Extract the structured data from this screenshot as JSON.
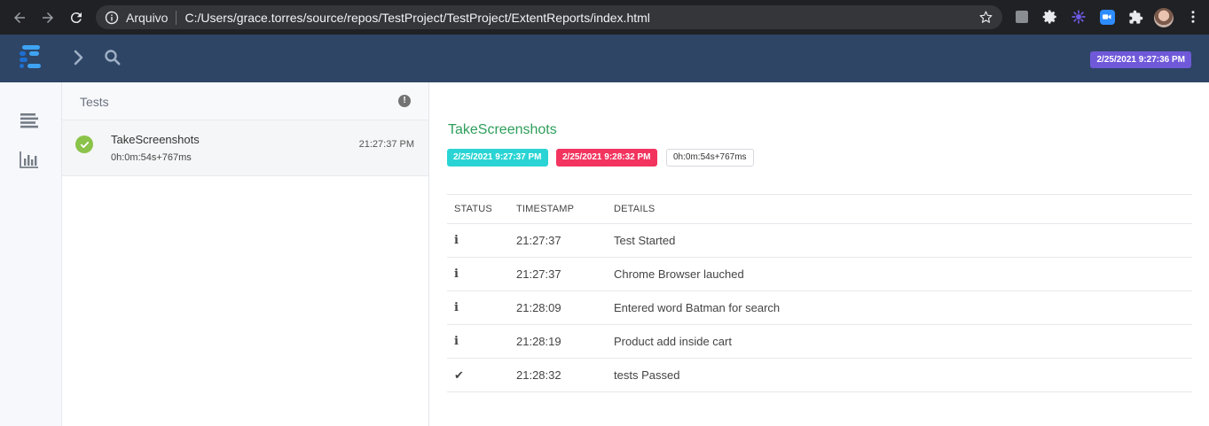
{
  "browser": {
    "protocol_label": "Arquivo",
    "url": "C:/Users/grace.torres/source/repos/TestProject/TestProject/ExtentReports/index.html",
    "icons": [
      "back-arrow-icon",
      "forward-arrow-icon",
      "reload-icon",
      "info-icon",
      "star-icon",
      "extension-icons",
      "puzzle-icon",
      "avatar",
      "more-vert-icon"
    ]
  },
  "header": {
    "report_datetime": "2/25/2021 9:27:36 PM",
    "colors": {
      "background": "#2e4566",
      "date_badge": "#6f59d9"
    }
  },
  "sidenav": {
    "items": [
      {
        "name": "test-view",
        "icon": "list-icon"
      },
      {
        "name": "dashboard",
        "icon": "bar-chart-icon"
      }
    ]
  },
  "test_list": {
    "title": "Tests",
    "items": [
      {
        "name": "TakeScreenshots",
        "duration": "0h:0m:54s+767ms",
        "time": "21:27:37 PM",
        "status": "pass"
      }
    ]
  },
  "test_detail": {
    "name": "TakeScreenshots",
    "start_time": "2/25/2021 9:27:37 PM",
    "end_time": "2/25/2021 9:28:32 PM",
    "duration": "0h:0m:54s+767ms",
    "columns": [
      "STATUS",
      "TIMESTAMP",
      "DETAILS"
    ],
    "logs": [
      {
        "status": "info",
        "status_glyph": "i",
        "timestamp": "21:27:37",
        "details": "Test Started"
      },
      {
        "status": "info",
        "status_glyph": "i",
        "timestamp": "21:27:37",
        "details": "Chrome Browser lauched"
      },
      {
        "status": "info",
        "status_glyph": "i",
        "timestamp": "21:28:09",
        "details": "Entered word Batman for search"
      },
      {
        "status": "info",
        "status_glyph": "i",
        "timestamp": "21:28:19",
        "details": "Product add inside cart"
      },
      {
        "status": "pass",
        "status_glyph": "✔",
        "timestamp": "21:28:32",
        "details": "tests Passed"
      }
    ],
    "colors": {
      "title": "#2e9e5b",
      "start_badge": "#2ad4d4",
      "end_badge": "#f2345f",
      "info": "#20b2c8",
      "pass": "#2e9e5b"
    }
  }
}
